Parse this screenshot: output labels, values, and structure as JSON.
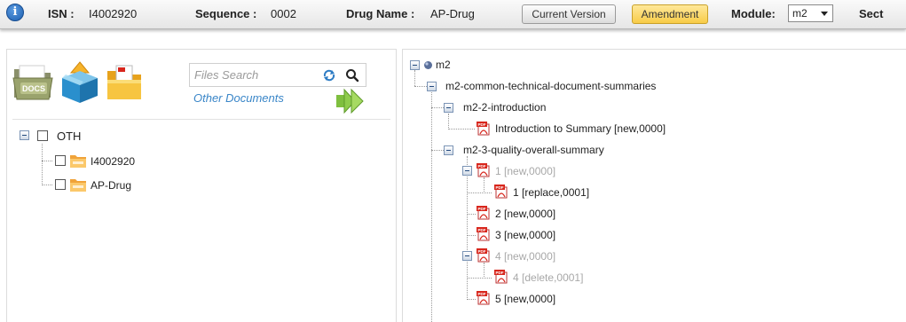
{
  "header": {
    "info_icon": "info-icon",
    "isn_label": "ISN :",
    "isn_value": "I4002920",
    "sequence_label": "Sequence :",
    "sequence_value": "0002",
    "drug_label": "Drug Name :",
    "drug_value": "AP-Drug",
    "current_version_btn": "Current Version",
    "amendment_btn": "Amendment",
    "module_label": "Module:",
    "module_value": "m2",
    "section_label": "Sect",
    "amendment_color": "#f8cc48"
  },
  "left_panel": {
    "icons": [
      "docs-folder-icon",
      "upload-box-icon",
      "pdf-folder-icon"
    ],
    "docs_badge": "DOCS",
    "search_placeholder": "Files Search",
    "other_documents": "Other Documents",
    "tree": {
      "root": "OTH",
      "children": [
        "I4002920",
        "AP-Drug"
      ]
    }
  },
  "right_panel": {
    "root": "m2",
    "n1": "m2-common-technical-document-summaries",
    "n2": "m2-2-introduction",
    "n2_1": "Introduction to Summary [new,0000]",
    "n3": "m2-3-quality-overall-summary",
    "items": [
      {
        "num": "1",
        "meta": "[new,0000]"
      },
      {
        "num": "1",
        "meta": "[replace,0001]"
      },
      {
        "num": "2",
        "meta": "[new,0000]"
      },
      {
        "num": "3",
        "meta": "[new,0000]"
      },
      {
        "num": "4",
        "meta": "[new,0000]"
      },
      {
        "num": "4",
        "meta": "[delete,0001]"
      },
      {
        "num": "5",
        "meta": "[new,0000]"
      }
    ]
  }
}
